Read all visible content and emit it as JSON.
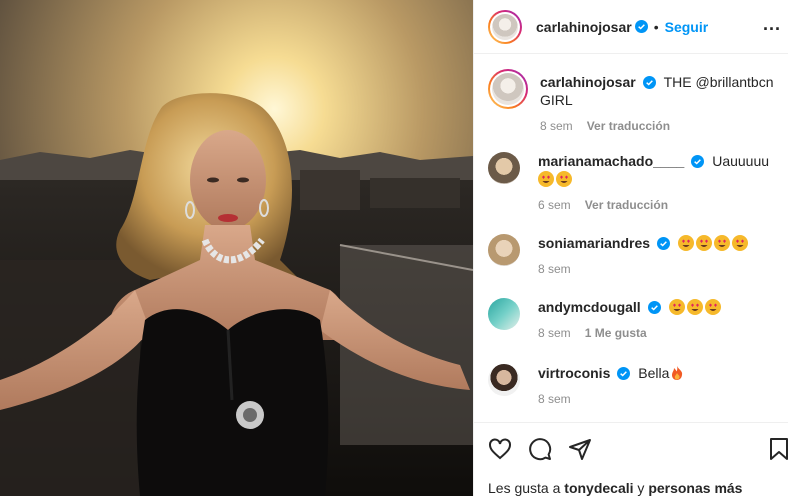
{
  "post": {
    "author": "carlahinojosar",
    "follow_label": "Seguir",
    "dot": "•",
    "more": "...",
    "caption_mention": "THE @brillantbcn",
    "caption_rest": "GIRL",
    "caption_time": "8 sem",
    "translate": "Ver traducción"
  },
  "comments": [
    {
      "user": "marianamachado____",
      "text": "Uauuuuu",
      "emoji_count": 2,
      "time": "6 sem",
      "action": "Ver traducción"
    },
    {
      "user": "soniamariandres",
      "text": "",
      "emoji_count": 4,
      "time": "8 sem",
      "action": ""
    },
    {
      "user": "andymcdougall",
      "text": "",
      "emoji_count": 3,
      "time": "8 sem",
      "action": "1 Me gusta"
    },
    {
      "user": "virtroconis",
      "text": "Bella",
      "emoji_count": 1,
      "time": "8 sem",
      "action": ""
    }
  ],
  "likes": {
    "prefix": "Les gusta a",
    "user": "tonydecali",
    "mid": "y",
    "suffix": "personas más"
  },
  "colors": {
    "accent": "#0095f6",
    "verified": "#0095f6",
    "muted": "#8e8e8e"
  },
  "icons": [
    "verified-icon",
    "more-icon",
    "heart-icon",
    "comment-icon",
    "share-icon",
    "bookmark-icon",
    "emoji-heart-eyes-icon",
    "emoji-fire-icon"
  ]
}
